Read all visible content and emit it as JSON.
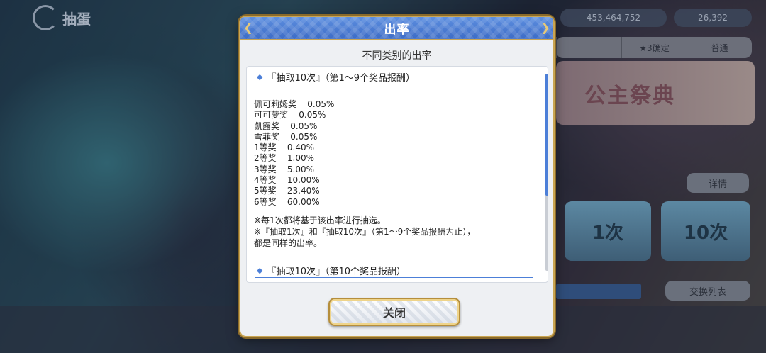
{
  "background": {
    "logo_text": "抽蛋",
    "currency1": "453,464,752",
    "currency2": "26,392",
    "tabs": [
      "",
      "★3确定",
      "普通"
    ],
    "banner_title": "公主祭典",
    "details_button": "详情",
    "draw1_label": "1次",
    "draw10_label": "10次",
    "exchange_button": "交换列表"
  },
  "dialog": {
    "title": "出率",
    "subtitle": "不同类别的出率",
    "section1_header": "『抽取10次』（第1～9个奖品报酬）",
    "rates": [
      {
        "name": "佩可莉姆奖",
        "rate": "0.05%"
      },
      {
        "name": "可可萝奖",
        "rate": "0.05%"
      },
      {
        "name": "凯露奖",
        "rate": "0.05%"
      },
      {
        "name": "雪菲奖",
        "rate": "0.05%"
      },
      {
        "name": "1等奖",
        "rate": "0.40%"
      },
      {
        "name": "2等奖",
        "rate": "1.00%"
      },
      {
        "name": "3等奖",
        "rate": "5.00%"
      },
      {
        "name": "4等奖",
        "rate": "10.00%"
      },
      {
        "name": "5等奖",
        "rate": "23.40%"
      },
      {
        "name": "6等奖",
        "rate": "60.00%"
      }
    ],
    "note1": "※每1次都将基于该出率进行抽选。",
    "note2": "※『抽取1次』和『抽取10次』（第1～9个奖品报酬为止），",
    "note3": "都是同样的出率。",
    "section2_header": "『抽取10次』（第10个奖品报酬）",
    "close_label": "关闭"
  },
  "colors": {
    "header_blue": "#4d7fd6",
    "gold_border": "#c9a552",
    "section_line": "#4c7fd8"
  }
}
